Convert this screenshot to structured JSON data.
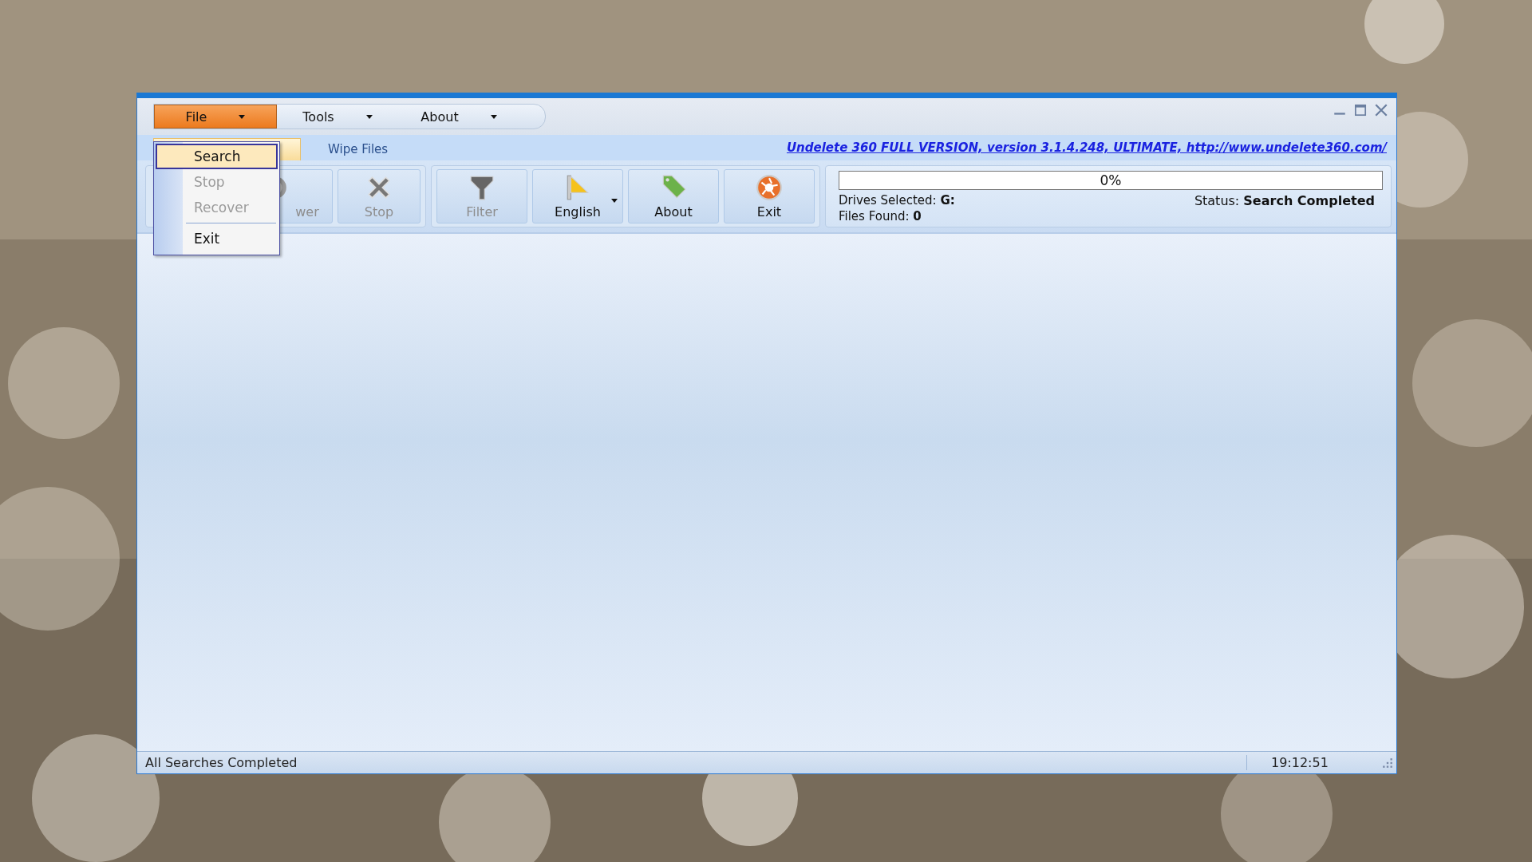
{
  "menu_bar": [
    {
      "label": "File",
      "open": true
    },
    {
      "label": "Tools",
      "open": false
    },
    {
      "label": "About",
      "open": false
    }
  ],
  "file_menu": [
    {
      "kind": "item",
      "label": "Search",
      "selected": true,
      "disabled": false
    },
    {
      "kind": "item",
      "label": "Stop",
      "selected": false,
      "disabled": true
    },
    {
      "kind": "item",
      "label": "Recover",
      "selected": false,
      "disabled": true
    },
    {
      "kind": "separator"
    },
    {
      "kind": "item",
      "label": "Exit",
      "selected": false,
      "disabled": false
    }
  ],
  "tabs": [
    {
      "selected": true
    },
    {
      "label": "Wipe Files",
      "selected": false
    }
  ],
  "link": "Undelete 360 FULL VERSION, version 3.1.4.248, ULTIMATE, http://www.undelete360.com/",
  "toolbar_groups": [
    [
      {
        "label": "wer",
        "disabled": true,
        "dropdown": false
      },
      {
        "label": "Stop",
        "disabled": true,
        "dropdown": false
      }
    ],
    [
      {
        "label": "Filter",
        "disabled": true,
        "dropdown": false
      },
      {
        "label": "English",
        "disabled": false,
        "dropdown": true
      },
      {
        "label": "About",
        "disabled": false,
        "dropdown": false
      },
      {
        "label": "Exit",
        "disabled": false,
        "dropdown": false
      }
    ]
  ],
  "progress": {
    "level": 0,
    "reading": "0%"
  },
  "drives_selected": "Drives Selected: **G:**",
  "files_found": "Files Found: **0**",
  "status": "Status: **Search Completed**",
  "status_bar": {
    "message": "All Searches Completed",
    "time": "19:12:51"
  }
}
